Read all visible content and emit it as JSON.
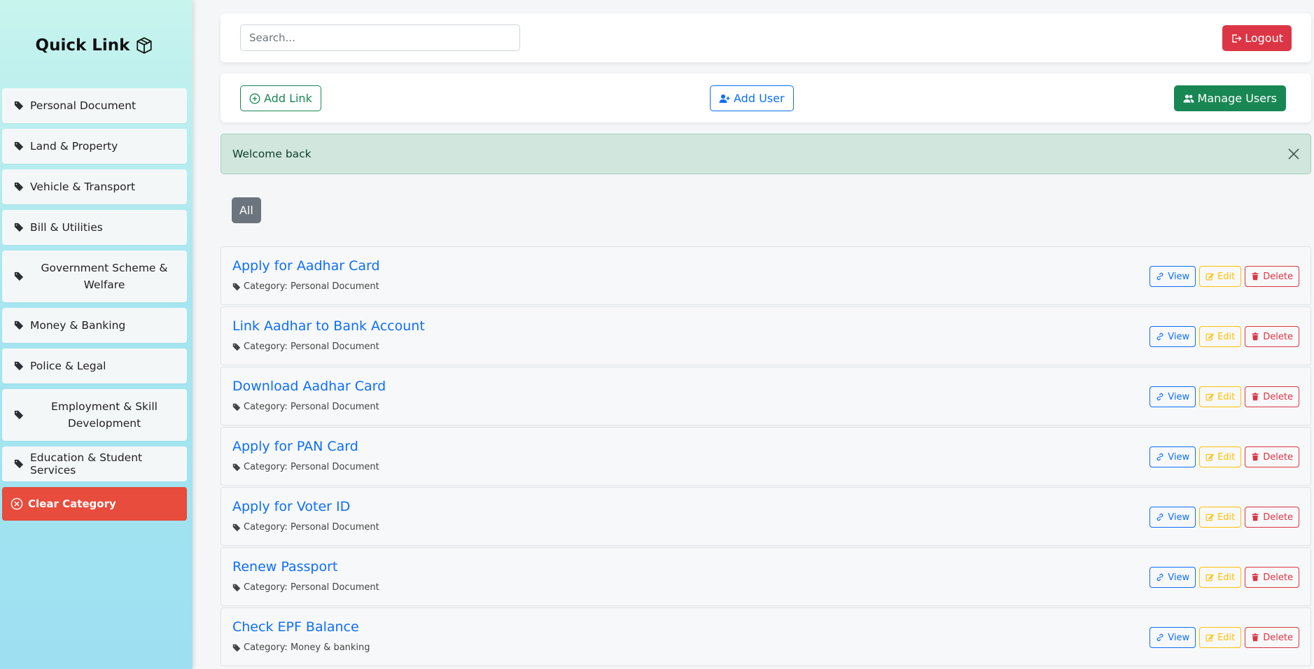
{
  "sidebar": {
    "brand": "Quick Link",
    "categories": [
      {
        "label": "Personal Document"
      },
      {
        "label": "Land & Property"
      },
      {
        "label": "Vehicle & Transport"
      },
      {
        "label": "Bill & Utilities"
      },
      {
        "label": "Government Scheme & Welfare"
      },
      {
        "label": "Money & Banking"
      },
      {
        "label": "Police & Legal"
      },
      {
        "label": "Employment & Skill Development"
      },
      {
        "label": "Education & Student Services"
      }
    ],
    "clear_label": "Clear Category"
  },
  "topbar": {
    "search_placeholder": "Search...",
    "logout_label": "Logout"
  },
  "actions": {
    "add_link_label": "Add Link",
    "add_user_label": "Add User",
    "manage_users_label": "Manage Users"
  },
  "alert": {
    "message": "Welcome back"
  },
  "filter": {
    "active_label": "All"
  },
  "links": [
    {
      "title": "Apply for Aadhar Card",
      "category": "Category: Personal Document"
    },
    {
      "title": "Link Aadhar to Bank Account",
      "category": "Category: Personal Document"
    },
    {
      "title": "Download Aadhar Card",
      "category": "Category: Personal Document"
    },
    {
      "title": "Apply for PAN Card",
      "category": "Category: Personal Document"
    },
    {
      "title": "Apply for Voter ID",
      "category": "Category: Personal Document"
    },
    {
      "title": "Renew Passport",
      "category": "Category: Personal Document"
    },
    {
      "title": "Check EPF Balance",
      "category": "Category: Money & banking"
    }
  ],
  "row_buttons": {
    "view_label": "View",
    "edit_label": "Edit",
    "delete_label": "Delete"
  },
  "colors": {
    "primary": "#0d6efd",
    "success": "#198754",
    "danger": "#dc3545",
    "warning": "#ffc107",
    "clear_category": "#e74c3c",
    "alert_bg": "#d1e7dd"
  }
}
